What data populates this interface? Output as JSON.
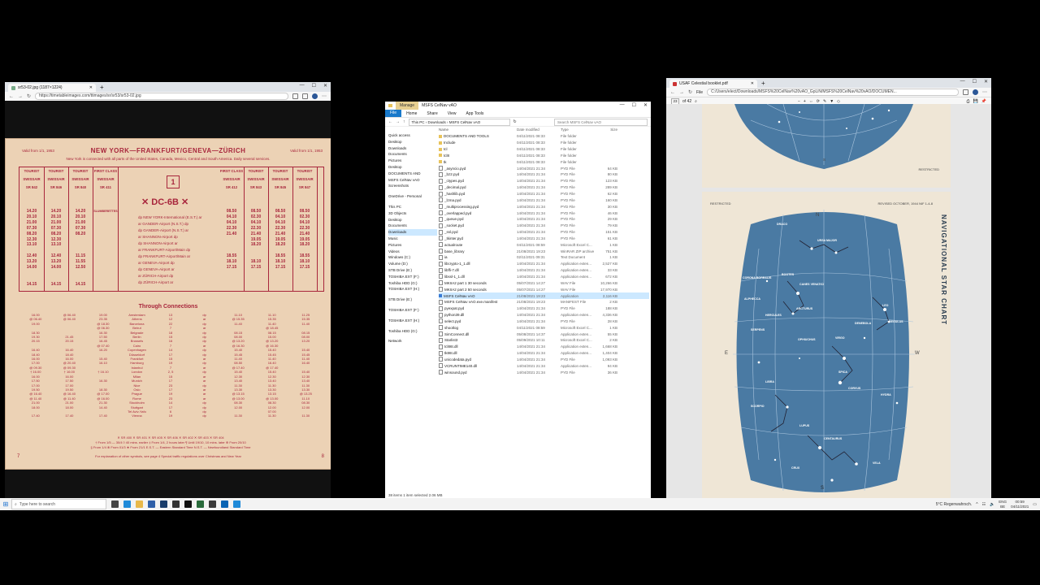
{
  "left_window": {
    "tab_title": "sr53-02.jpg (1187×1224)",
    "url": "https://timetableimages.com/ttimages/sr/sr53/sr53-02.jpg"
  },
  "timetable": {
    "valid_left": "Valid from 1/1, 1953",
    "valid_right": "Valid from 1/1, 1953",
    "title": "NEW YORK—FRANKFURT/GENEVA—ZÜRICH",
    "subtitle": "New York is connected with all parts of the United States, Canada, Mexico, Central and South America. Daily several services.",
    "flight_number": "1",
    "aircraft": "✕ DC-6B ✕",
    "columns": [
      {
        "class": "TOURIST",
        "airline": "SWISSAIR",
        "flight": "SR 842",
        "times": [
          "14.20",
          "20.10",
          "21.00",
          "07.30",
          "08.20",
          "12.30",
          "13.10",
          "",
          "12.40",
          "13.20",
          "14.00",
          "",
          "",
          "14.15"
        ]
      },
      {
        "class": "TOURIST",
        "airline": "SWISSAIR",
        "flight": "SR 846",
        "times": [
          "14.20",
          "20.10",
          "21.00",
          "07.30",
          "08.20",
          "12.30",
          "13.10",
          "",
          "12.40",
          "13.20",
          "14.00",
          "",
          "",
          "14.15"
        ]
      },
      {
        "class": "TOURIST",
        "airline": "SWISSAIR",
        "flight": "SR 840",
        "times": [
          "14.20",
          "20.10",
          "21.00",
          "07.30",
          "08.20",
          "",
          "",
          "",
          "11.15",
          "11.55",
          "12.50",
          "",
          "",
          "14.15"
        ]
      },
      {
        "class": "FIRST CLASS",
        "airline": "SWISSAIR",
        "flight": "SR 411",
        "times": [
          "SLUMBERETTES",
          "",
          "",
          "",
          "",
          "",
          "",
          "",
          "",
          "",
          "",
          "",
          "",
          ""
        ]
      },
      {
        "class": "FIRST CLASS",
        "airline": "SWISSAIR",
        "flight": "SR 412",
        "times": [
          "08.50",
          "04.10",
          "04.10",
          "22.30",
          "21.40",
          "",
          "",
          "",
          "18.55",
          "18.10",
          "17.15",
          "",
          "",
          ""
        ]
      },
      {
        "class": "TOURIST",
        "airline": "SWISSAIR",
        "flight": "SR 843",
        "times": [
          "08.50",
          "02.30",
          "04.10",
          "22.30",
          "21.40",
          "19.05",
          "18.20",
          "",
          "",
          "18.10",
          "17.15",
          "",
          "",
          ""
        ]
      },
      {
        "class": "TOURIST",
        "airline": "SWISSAIR",
        "flight": "SR 845",
        "times": [
          "08.50",
          "04.10",
          "04.10",
          "22.30",
          "21.40",
          "19.05",
          "18.20",
          "",
          "18.55",
          "18.10",
          "17.15",
          "",
          "",
          ""
        ]
      },
      {
        "class": "TOURIST",
        "airline": "SWISSAIR",
        "flight": "SR 847",
        "times": [
          "08.50",
          "02.30",
          "04.10",
          "22.30",
          "21.40",
          "19.05",
          "18.20",
          "",
          "18.55",
          "18.10",
          "17.15",
          "",
          "",
          ""
        ]
      }
    ],
    "stations": [
      "dp NEW YORK-International (E.S.T.) ar",
      "ar GANDER-Airport (N.S.T.) dp",
      "dp GANDER-Airport (N.S.T.) ar",
      "ar SHANNON-Airport dp",
      "dp SHANNON-Airport ar",
      "ar FRANKFURT-Airport/Main dp",
      "dp FRANKFURT-Airport/Main ar",
      "ar GENEVA-Airport dp",
      "dp GENEVA-Airport ar",
      "ar ZÜRICH-Airport dp",
      "dp ZÜRICH-Airport ar"
    ],
    "through_title": "Through Connections",
    "through_rows": [
      [
        "16.00",
        "@ 06.40",
        "19.00",
        "Amsterdam",
        "13",
        "dp",
        "11.10",
        "11.10",
        "11.25"
      ],
      [
        "@ 06.40",
        "@ 06.40",
        "23.35",
        "Athens",
        "12",
        "ar",
        "@ 15.35",
        "15.35",
        "15.35"
      ],
      [
        "19.00",
        "",
        "@ 18.30",
        "Barcelona",
        "22",
        "dp",
        "11.40",
        "11.40",
        "11.40"
      ],
      [
        "",
        "",
        "@ 06.30",
        "Beirut",
        "7",
        "ar",
        "",
        "@ 18.45",
        ""
      ],
      [
        "18.30",
        "",
        "16.30",
        "Belgrade",
        "18",
        "dp",
        "08.15",
        "08.15",
        "08.15"
      ],
      [
        "19.30",
        "21.45",
        "17.50",
        "Berlin",
        "15",
        "dp",
        "08.00",
        "15.00",
        "08.00"
      ],
      [
        "20.15",
        "20.15",
        "16.45",
        "Brussels",
        "16",
        "dp",
        "@ 13.20",
        "@ 13.20",
        "13.20"
      ],
      [
        "",
        "",
        "@ 07.40",
        "Cairo",
        "7",
        "ar",
        "@ 16.30",
        "@ 16.30",
        ""
      ],
      [
        "16.40",
        "16.40",
        "16.20",
        "Copenhagen",
        "14",
        "dp",
        "15.40",
        "15.40",
        "15.40"
      ],
      [
        "18.40",
        "18.40",
        "",
        "Düsseldorf",
        "17",
        "dp",
        "15.45",
        "15.45",
        "15.45"
      ],
      [
        "16.00",
        "16.00",
        "15.40",
        "Frankfurt",
        "15",
        "ar",
        "11.40",
        "11.40",
        "11.40"
      ],
      [
        "17.00",
        "@ 20.40",
        "16.10",
        "Hamburg",
        "19",
        "dp",
        "08.50",
        "16.40",
        "16.40"
      ],
      [
        "@ 09.30",
        "@ 09.30",
        "",
        "Istanbul",
        "7",
        "ar",
        "@ 17.40",
        "@ 17.40",
        ""
      ],
      [
        "† 16.00",
        "† 16.00",
        "† 16.10",
        "London",
        "2, 5",
        "dp",
        "15.40",
        "15.40",
        "15.40"
      ],
      [
        "16.00",
        "16.00",
        "",
        "Milan",
        "15",
        "ar",
        "12.30",
        "12.30",
        "12.30"
      ],
      [
        "17.50",
        "17.50",
        "16.30",
        "Munich",
        "17",
        "ar",
        "13.40",
        "13.40",
        "13.40"
      ],
      [
        "17.00",
        "17.00",
        "",
        "Nice",
        "23",
        "dp",
        "11.30",
        "11.30",
        "11.30"
      ],
      [
        "19.50",
        "19.50",
        "18.30",
        "Oslo",
        "17",
        "ar",
        "13.30",
        "13.30",
        "13.30"
      ],
      [
        "@ 16.40",
        "@ 16.40",
        "@ 17.00",
        "Prague",
        "19",
        "ar",
        "@ 13.15",
        "13.15",
        "@ 13.25"
      ],
      [
        "@ 11.40",
        "@ 11.40",
        "@ 16.00",
        "Rome",
        "23",
        "ar",
        "@ 13.00",
        "@ 13.00",
        "11.10"
      ],
      [
        "21.00",
        "21.00",
        "21.30",
        "Stockholm",
        "14",
        "dp",
        "08.30",
        "08.30",
        "08.30"
      ],
      [
        "18.00",
        "18.00",
        "14.40",
        "Stuttgart",
        "17",
        "dp",
        "12.00",
        "12.00",
        "12.00"
      ],
      [
        "",
        "",
        "",
        "Tel Aviv-Yafo",
        "6",
        "dp",
        "",
        "07.00",
        ""
      ],
      [
        "17.40",
        "17.40",
        "17.40",
        "Vienna",
        "19",
        "dp",
        "11.30",
        "11.30",
        "11.30"
      ]
    ],
    "footer_1": "✕ SR 400   ✕ SR 401   ✕ SR 405   ✕ SR 406   ✕ SR 402   ✕ SR 403   ✕ SR 404",
    "footer_2": "† From 1/5 — 30/4  ◊ 40 mins. earlier  ‡ From 1/4, 2 hours later  ¶ Until 19/10, 10 mins. later  ⊕ From 20/10",
    "footer_3": "§ From 1/4   ⊗ From 01/3   ★ From 21/1   E.S.T. — Eastern Standard Time   N.S.T. — Newfoundland Standard Time",
    "page_left": "7",
    "page_right": "8",
    "bottom_note": "For explanation of other symbols, see page 4          Special traffic regulations over Christmas and New Year"
  },
  "explorer": {
    "manage_label": "Manage",
    "title": "MSFS CelNav vAO",
    "ribbon": [
      "File",
      "Home",
      "Share",
      "View",
      "App Tools"
    ],
    "path": "This PC  ›  Downloads  ›  MSFS CelNav vAO",
    "search_placeholder": "Search MSFS CelNav vAO",
    "nav": [
      {
        "label": "Quick access",
        "sel": false
      },
      {
        "label": "Desktop",
        "sel": false
      },
      {
        "label": "Downloads",
        "sel": false
      },
      {
        "label": "Documents",
        "sel": false
      },
      {
        "label": "Pictures",
        "sel": false
      },
      {
        "label": "Desktop",
        "sel": false
      },
      {
        "label": "DOCUMENTS AND",
        "sel": false
      },
      {
        "label": "MSFS CelNav vAO",
        "sel": false
      },
      {
        "label": "Screenshots",
        "sel": false
      },
      {
        "label": "",
        "sel": false
      },
      {
        "label": "OneDrive - Personal",
        "sel": false
      },
      {
        "label": "",
        "sel": false
      },
      {
        "label": "This PC",
        "sel": false
      },
      {
        "label": "3D Objects",
        "sel": false
      },
      {
        "label": "Desktop",
        "sel": false
      },
      {
        "label": "Documents",
        "sel": false
      },
      {
        "label": "Downloads",
        "sel": true
      },
      {
        "label": "Music",
        "sel": false
      },
      {
        "label": "Pictures",
        "sel": false
      },
      {
        "label": "Videos",
        "sel": false
      },
      {
        "label": "Windows (C:)",
        "sel": false
      },
      {
        "label": "Volume (D:)",
        "sel": false
      },
      {
        "label": "STB Drive (E:)",
        "sel": false
      },
      {
        "label": "TOSHIBA EXT (F:)",
        "sel": false
      },
      {
        "label": "Toshiba HDD (G:)",
        "sel": false
      },
      {
        "label": "TOSHIBA EXT (H:)",
        "sel": false
      },
      {
        "label": "",
        "sel": false
      },
      {
        "label": "STB Drive (E:)",
        "sel": false
      },
      {
        "label": "",
        "sel": false
      },
      {
        "label": "TOSHIBA EXT (F:)",
        "sel": false
      },
      {
        "label": "",
        "sel": false
      },
      {
        "label": "TOSHIBA EXT (H:)",
        "sel": false
      },
      {
        "label": "",
        "sel": false
      },
      {
        "label": "Toshiba HDD (G:)",
        "sel": false
      },
      {
        "label": "",
        "sel": false
      },
      {
        "label": "Network",
        "sel": false
      }
    ],
    "columns": [
      "Name",
      "Date modified",
      "Type",
      "Size"
    ],
    "files": [
      {
        "name": "DOCUMENTS AND TOOLS",
        "date": "04/11/2021 08:33",
        "type": "File folder",
        "size": "",
        "kind": "folder"
      },
      {
        "name": "Include",
        "date": "04/11/2021 08:33",
        "type": "File folder",
        "size": "",
        "kind": "folder"
      },
      {
        "name": "tcl",
        "date": "04/11/2021 08:33",
        "type": "File folder",
        "size": "",
        "kind": "folder"
      },
      {
        "name": "tcl8",
        "date": "04/11/2021 08:33",
        "type": "File folder",
        "size": "",
        "kind": "folder"
      },
      {
        "name": "tk",
        "date": "04/11/2021 08:33",
        "type": "File folder",
        "size": "",
        "kind": "folder"
      },
      {
        "name": "_asyncio.pyd",
        "date": "14/04/2021 21:34",
        "type": "PYD File",
        "size": "64 KB",
        "kind": "file"
      },
      {
        "name": "_bz2.pyd",
        "date": "14/04/2021 21:34",
        "type": "PYD File",
        "size": "80 KB",
        "kind": "file"
      },
      {
        "name": "_ctypes.pyd",
        "date": "14/04/2021 21:34",
        "type": "PYD File",
        "size": "123 KB",
        "kind": "file"
      },
      {
        "name": "_decimal.pyd",
        "date": "14/04/2021 21:34",
        "type": "PYD File",
        "size": "289 KB",
        "kind": "file"
      },
      {
        "name": "_hashlib.pyd",
        "date": "14/04/2021 21:34",
        "type": "PYD File",
        "size": "62 KB",
        "kind": "file"
      },
      {
        "name": "_lzma.pyd",
        "date": "14/04/2021 21:34",
        "type": "PYD File",
        "size": "160 KB",
        "kind": "file"
      },
      {
        "name": "_multiprocessing.pyd",
        "date": "14/04/2021 21:34",
        "type": "PYD File",
        "size": "30 KB",
        "kind": "file"
      },
      {
        "name": "_overlapped.pyd",
        "date": "14/04/2021 21:34",
        "type": "PYD File",
        "size": "46 KB",
        "kind": "file"
      },
      {
        "name": "_queue.pyd",
        "date": "14/04/2021 21:34",
        "type": "PYD File",
        "size": "29 KB",
        "kind": "file"
      },
      {
        "name": "_socket.pyd",
        "date": "14/04/2021 21:34",
        "type": "PYD File",
        "size": "79 KB",
        "kind": "file"
      },
      {
        "name": "_ssl.pyd",
        "date": "14/04/2021 21:34",
        "type": "PYD File",
        "size": "151 KB",
        "kind": "file"
      },
      {
        "name": "_tkinter.pyd",
        "date": "14/04/2021 21:34",
        "type": "PYD File",
        "size": "61 KB",
        "kind": "file"
      },
      {
        "name": "actualroute",
        "date": "04/11/2021 08:59",
        "type": "Microsoft Excel C...",
        "size": "1 KB",
        "kind": "file"
      },
      {
        "name": "base_library",
        "date": "21/08/2021 19:23",
        "type": "WinRAR ZIP archive",
        "size": "751 KB",
        "kind": "file"
      },
      {
        "name": "ia",
        "date": "02/11/2021 09:31",
        "type": "Text Document",
        "size": "1 KB",
        "kind": "file"
      },
      {
        "name": "libcrypto-1_1.dll",
        "date": "14/04/2021 21:34",
        "type": "Application exten...",
        "size": "2,527 KB",
        "kind": "file"
      },
      {
        "name": "libffi-7.dll",
        "date": "14/04/2021 21:34",
        "type": "Application exten...",
        "size": "33 KB",
        "kind": "file"
      },
      {
        "name": "libssl-1_1.dll",
        "date": "14/04/2021 21:34",
        "type": "Application exten...",
        "size": "672 KB",
        "kind": "file"
      },
      {
        "name": "MKIIA2 part 1 30 seconds",
        "date": "05/07/2021 14:27",
        "type": "WAV File",
        "size": "10,266 KB",
        "kind": "file"
      },
      {
        "name": "MKIIA2 part 2 50 seconds",
        "date": "05/07/2021 14:27",
        "type": "WAV File",
        "size": "17,970 KB",
        "kind": "file"
      },
      {
        "name": "MSFS CelNav vAO",
        "date": "21/08/2021 19:23",
        "type": "Application",
        "size": "2,116 KB",
        "kind": "app",
        "sel": true
      },
      {
        "name": "MSFS CelNav vAO.exe.manifest",
        "date": "21/08/2021 19:23",
        "type": "MANIFEST File",
        "size": "2 KB",
        "kind": "file"
      },
      {
        "name": "pyexpat.pyd",
        "date": "14/04/2021 21:34",
        "type": "PYD File",
        "size": "188 KB",
        "kind": "file"
      },
      {
        "name": "python39.dll",
        "date": "14/04/2021 21:34",
        "type": "Application exten...",
        "size": "4,336 KB",
        "kind": "file"
      },
      {
        "name": "select.pyd",
        "date": "14/04/2021 21:34",
        "type": "PYD File",
        "size": "28 KB",
        "kind": "file"
      },
      {
        "name": "shootlog",
        "date": "04/11/2021 08:59",
        "type": "Microsoft Excel C...",
        "size": "1 KB",
        "kind": "file"
      },
      {
        "name": "SimConnect.dll",
        "date": "05/08/2021 14:37",
        "type": "Application exten...",
        "size": "55 KB",
        "kind": "file"
      },
      {
        "name": "Starlist3",
        "date": "05/09/2021 10:11",
        "type": "Microsoft Excel C...",
        "size": "2 KB",
        "kind": "file"
      },
      {
        "name": "tcl86t.dll",
        "date": "14/04/2021 21:34",
        "type": "Application exten...",
        "size": "1,668 KB",
        "kind": "file"
      },
      {
        "name": "tk86t.dll",
        "date": "14/04/2021 21:34",
        "type": "Application exten...",
        "size": "1,404 KB",
        "kind": "file"
      },
      {
        "name": "unicodedata.pyd",
        "date": "14/04/2021 21:34",
        "type": "PYD File",
        "size": "1,093 KB",
        "kind": "file"
      },
      {
        "name": "VCRUNTIME140.dll",
        "date": "14/04/2021 21:34",
        "type": "Application exten...",
        "size": "94 KB",
        "kind": "file"
      },
      {
        "name": "winsound.pyd",
        "date": "14/04/2021 21:34",
        "type": "PYD File",
        "size": "36 KB",
        "kind": "file"
      }
    ],
    "status": "38 items    1 item selected  2.06 MB"
  },
  "pdf_window": {
    "tab_title": "USAF Celestial booklet.pdf",
    "url_prefix": "File",
    "url": "C:/Users/elect/Downloads/MSFS%20CelNav%20vAO_GpLiN/MSFS%20CelNav%20vAO/DOCUMEN...",
    "page_num": "23",
    "page_total": "of 42",
    "page1_restricted": "RESTRICTED",
    "page1_south": "S",
    "page2_restricted": "RESTRICTED",
    "page2_revised": "REVISED OCTOBER, 1944  NIF 1-4-8",
    "chart_title": "NAVIGATIONAL STAR CHART",
    "north": "N",
    "south": "S",
    "east": "E",
    "west": "W",
    "constellations": [
      "DRACO",
      "URSA MAJOR",
      "CORONA BOREALIS",
      "BOOTES",
      "CANES VENATICI",
      "ARCTURUS",
      "ALPHECCA",
      "HERCULES",
      "SERPENS",
      "OPHIUCHUS",
      "LEO",
      "DENEBOLA",
      "REGULUS",
      "VIRGO",
      "SPICA",
      "CORVUS",
      "HYDRA",
      "LIBRA",
      "SCORPIO",
      "LUPUS",
      "CENTAURUS",
      "CRUX",
      "VELA"
    ]
  },
  "taskbar": {
    "search_placeholder": "Type here to search",
    "weather": "5°C  Regenwahrsch.",
    "lang": "ENG",
    "lang2": "BE",
    "time": "00:59",
    "date": "04/11/2021"
  }
}
